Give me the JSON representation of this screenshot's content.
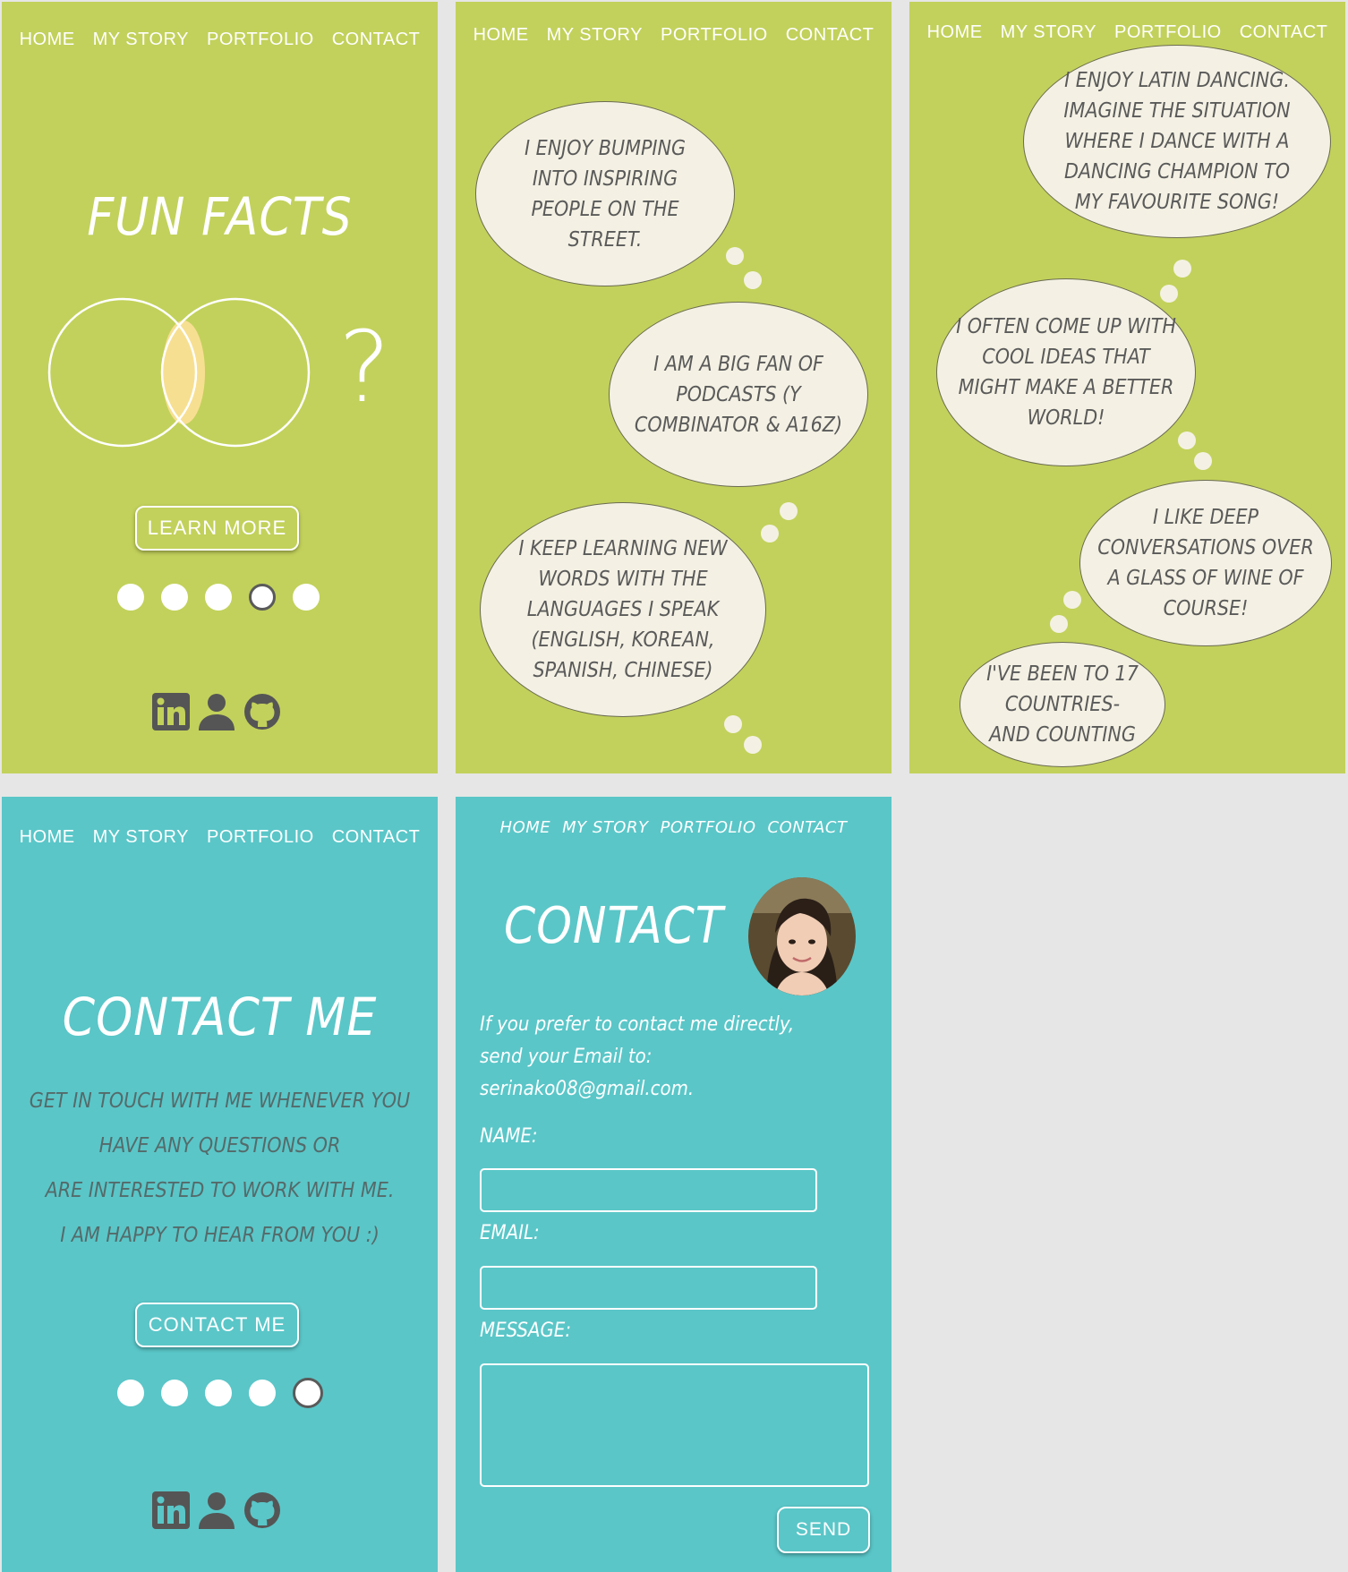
{
  "nav": {
    "home": "HOME",
    "my_story": "MY STORY",
    "portfolio": "PORTFOLIO",
    "contact": "CONTACT"
  },
  "colors": {
    "green_panel": "#c2d15b",
    "teal_panel": "#5ac6c8",
    "bubble": "#f4f1e4",
    "venn_highlight": "#f7df92"
  },
  "panel1": {
    "title": "FUN FACTS",
    "question_mark": "?",
    "button": "LEARN MORE",
    "active_dot": 4,
    "dot_count": 5,
    "icons": [
      "linkedin-icon",
      "user-icon",
      "github-icon"
    ]
  },
  "panel2": {
    "bubbles": [
      "I ENJOY BUMPING INTO INSPIRING PEOPLE ON THE STREET.",
      "I AM A BIG FAN OF PODCASTS (Y COMBINATOR & A16Z)",
      "I KEEP LEARNING NEW WORDS WITH THE LANGUAGES I SPEAK (ENGLISH, KOREAN, SPANISH, CHINESE)"
    ]
  },
  "panel3": {
    "bubbles": [
      "I ENJOY LATIN DANCING. IMAGINE THE SITUATION WHERE I DANCE WITH A DANCING CHAMPION TO MY FAVOURITE SONG!",
      "I OFTEN COME UP WITH COOL IDEAS THAT MIGHT MAKE A BETTER WORLD!",
      "I LIKE DEEP CONVERSATIONS OVER A GLASS OF WINE OF COURSE!",
      "I'VE BEEN TO 17 COUNTRIES-AND COUNTING"
    ]
  },
  "panel4": {
    "title": "CONTACT ME",
    "lines": [
      "GET IN TOUCH WITH ME WHENEVER YOU",
      "HAVE ANY QUESTIONS OR",
      "ARE INTERESTED TO WORK WITH ME.",
      "I AM HAPPY TO HEAR FROM YOU :)"
    ],
    "button": "CONTACT ME",
    "active_dot": 5,
    "dot_count": 5,
    "icons": [
      "linkedin-icon",
      "user-icon",
      "github-icon"
    ]
  },
  "panel5": {
    "title": "CONTACT",
    "intro_line1": "If you prefer to contact me directly,",
    "intro_line2": "send your Email to:",
    "email": "serinako08@gmail.com.",
    "name_label": "NAME:",
    "email_label": "EMAIL:",
    "message_label": "MESSAGE:",
    "name_value": "",
    "email_value": "",
    "message_value": "",
    "send": "SEND"
  }
}
